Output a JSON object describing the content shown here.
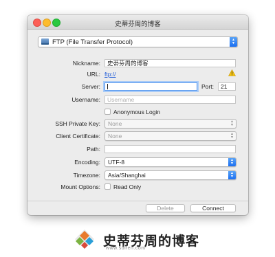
{
  "window": {
    "title": "史蒂芬周的博客"
  },
  "protocol": {
    "selected": "FTP (File Transfer Protocol)"
  },
  "form": {
    "nickname_label": "Nickname:",
    "nickname_value": "史蒂芬周的博客",
    "url_label": "URL:",
    "url_value": "ftp://",
    "server_label": "Server:",
    "server_value": "",
    "port_label": "Port:",
    "port_value": "21",
    "username_label": "Username:",
    "username_placeholder": "Username",
    "anonymous_label": "Anonymous Login",
    "ssh_key_label": "SSH Private Key:",
    "ssh_key_value": "None",
    "client_cert_label": "Client Certificate:",
    "client_cert_value": "None",
    "path_label": "Path:",
    "path_value": "",
    "encoding_label": "Encoding:",
    "encoding_value": "UTF-8",
    "timezone_label": "Timezone:",
    "timezone_value": "Asia/Shanghai",
    "mount_label": "Mount Options:",
    "readonly_label": "Read Only"
  },
  "buttons": {
    "delete": "Delete",
    "connect": "Connect"
  },
  "watermark": {
    "title": "史蒂芬周的博客",
    "url": "www.sdifen.com"
  },
  "colors": {
    "accent": "#1b6ff2",
    "link": "#1f5bd8",
    "warning": "#f0b400"
  },
  "icons": [
    "drive-icon",
    "warning-icon",
    "chevron-up-down-icon"
  ]
}
